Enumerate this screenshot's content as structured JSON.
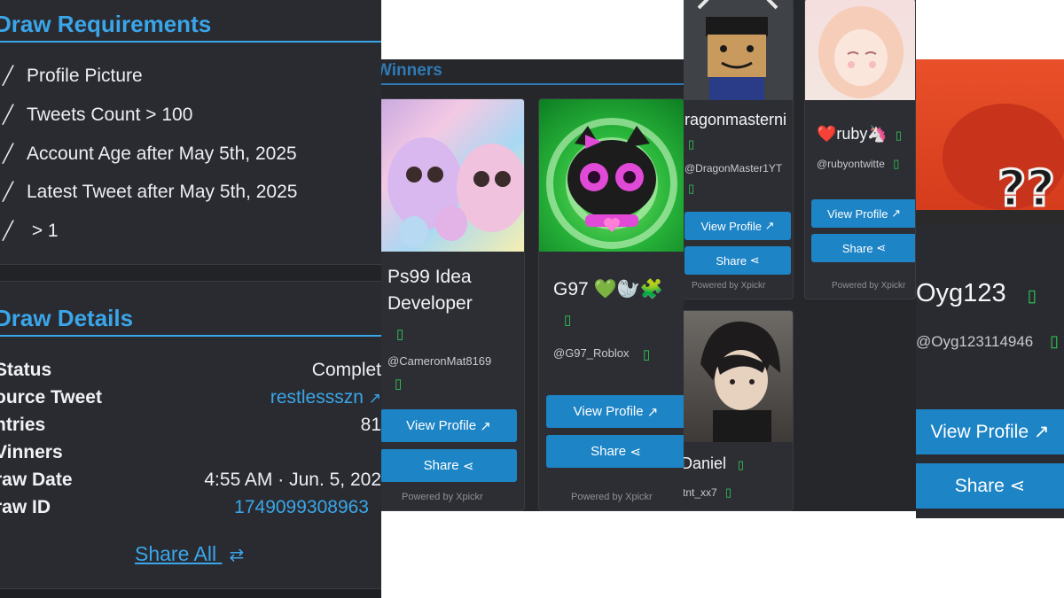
{
  "requirements": {
    "title": "Draw Requirements",
    "items": [
      "Profile Picture",
      "Tweets Count > 100",
      "Account Age after May 5th, 2025",
      "Latest Tweet after May 5th, 2025",
      " > 1"
    ],
    "check_icon": "check-icon"
  },
  "details": {
    "title": "Draw Details",
    "rows": [
      {
        "label": "Status",
        "value": "Complet"
      },
      {
        "label": "ource Tweet",
        "value": "restlessszn"
      },
      {
        "label": "ntries",
        "value": "81"
      },
      {
        "label": "Vinners",
        "value": ""
      },
      {
        "label": "raw Date",
        "value": "4:55 AM · Jun. 5, 202"
      },
      {
        "label": "raw ID",
        "value": "1749099308963"
      }
    ],
    "share_all": "Share All"
  },
  "winners": {
    "heading": "Winners",
    "cards": [
      {
        "name_line1": "Ps99 Idea",
        "name_line2": "Developer",
        "handle": "@CameronMat8169",
        "view_profile": "View Profile",
        "share": "Share",
        "powered": "Powered by Xpickr"
      },
      {
        "name": "G97 💚🦭🧩",
        "handle": "@G97_Roblox",
        "view_profile": "View Profile",
        "share": "Share",
        "powered": "Powered by Xpickr"
      },
      {
        "name": "ragonmasterni",
        "handle": "@DragonMaster1YT",
        "view_profile": "View Profile",
        "share": "Share",
        "powered": "Powered by Xpickr"
      },
      {
        "name": "❤️ruby🦄",
        "handle": "@rubyontwitte",
        "view_profile": "View Profile",
        "share": "Share",
        "powered": "Powered by Xpickr"
      },
      {
        "name": "Daniel",
        "handle": "tnt_xx7"
      },
      {
        "name": "Oyg123",
        "handle": "@Oyg123114946",
        "view_profile": "View Profile",
        "share": "Share"
      }
    ]
  },
  "colors": {
    "accent": "#3aa6ea",
    "button": "#1d84c6",
    "panel_bg": "#2a2b30",
    "clipboard_green": "#2ecc55"
  },
  "icons": [
    "check-icon",
    "clipboard-icon",
    "external-link-icon",
    "share-icon",
    "retweet-icon"
  ]
}
